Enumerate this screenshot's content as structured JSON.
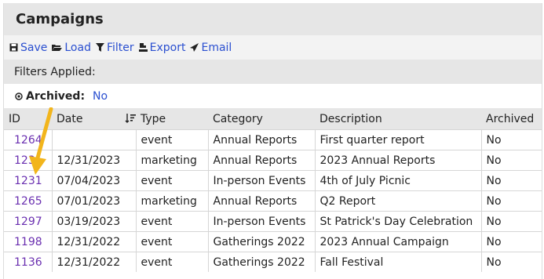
{
  "page": {
    "title": "Campaigns"
  },
  "toolbar": {
    "save_label": "Save",
    "load_label": "Load",
    "filter_label": "Filter",
    "export_label": "Export",
    "email_label": "Email"
  },
  "filters": {
    "heading": "Filters Applied:",
    "archived_label": "Archived:",
    "archived_value": "No"
  },
  "table": {
    "columns": [
      "ID",
      "Date",
      "Type",
      "Category",
      "Description",
      "Archived"
    ],
    "rows": [
      {
        "id": "1264",
        "date": "",
        "type": "event",
        "category": "Annual Reports",
        "description": "First quarter report",
        "archived": "No"
      },
      {
        "id": "123",
        "date": "12/31/2023",
        "type": "marketing",
        "category": "Annual Reports",
        "description": "2023 Annual Reports",
        "archived": "No"
      },
      {
        "id": "1231",
        "date": "07/04/2023",
        "type": "event",
        "category": "In-person Events",
        "description": "4th of July Picnic",
        "archived": "No"
      },
      {
        "id": "1265",
        "date": "07/01/2023",
        "type": "marketing",
        "category": "Annual Reports",
        "description": "Q2 Report",
        "archived": "No"
      },
      {
        "id": "1297",
        "date": "03/19/2023",
        "type": "event",
        "category": "In-person Events",
        "description": "St Patrick's Day Celebration",
        "archived": "No"
      },
      {
        "id": "1198",
        "date": "12/31/2022",
        "type": "event",
        "category": "Gatherings 2022",
        "description": "2023 Annual Campaign",
        "archived": "No"
      },
      {
        "id": "1136",
        "date": "12/31/2022",
        "type": "event",
        "category": "Gatherings 2022",
        "description": "Fall Festival",
        "archived": "No"
      }
    ]
  },
  "colors": {
    "link": "#2a4fd0",
    "id_link": "#6a2fb0",
    "header_bg": "#e6e6e6",
    "arrow": "#f2b51c"
  }
}
